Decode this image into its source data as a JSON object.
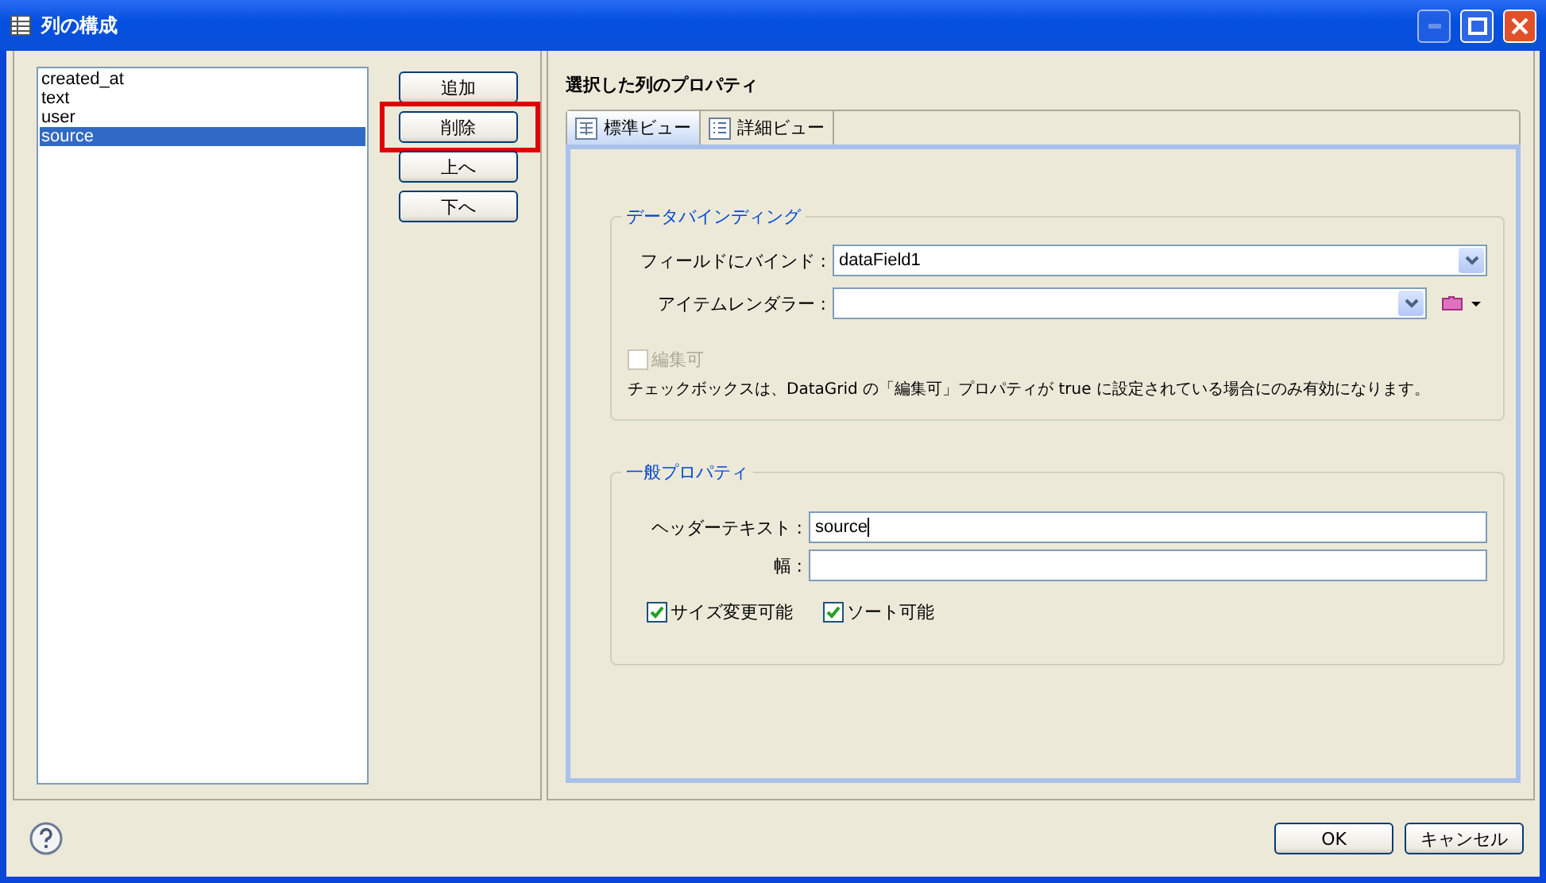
{
  "window": {
    "title": "列の構成"
  },
  "columns_list": {
    "items": [
      {
        "label": "created_at",
        "selected": false
      },
      {
        "label": "text",
        "selected": false
      },
      {
        "label": "user",
        "selected": false
      },
      {
        "label": "source",
        "selected": true
      }
    ]
  },
  "list_buttons": [
    {
      "label": "追加",
      "highlighted": false
    },
    {
      "label": "削除",
      "highlighted": true
    },
    {
      "label": "上へ",
      "highlighted": false
    },
    {
      "label": "下へ",
      "highlighted": false
    }
  ],
  "properties": {
    "title": "選択した列のプロパティ",
    "tabs": [
      {
        "label": "標準ビュー",
        "selected": true,
        "kind": "grid"
      },
      {
        "label": "詳細ビュー",
        "selected": false,
        "kind": "list"
      }
    ],
    "data_binding": {
      "title": "データバインディング",
      "field_label": "フィールドにバインド :",
      "field_value": "dataField1",
      "renderer_label": "アイテムレンダラー :",
      "editable": {
        "label": "編集可",
        "checked": false,
        "disabled": true
      },
      "note": "チェックボックスは、DataGrid の「編集可」プロパティが true に設定されている場合にのみ有効になります。"
    },
    "general": {
      "title": "一般プロパティ",
      "header_label": "ヘッダーテキスト :",
      "header_value": "source",
      "width_label": "幅 :",
      "checkboxes": [
        {
          "label": "サイズ変更可能",
          "checked": true,
          "disabled": false
        },
        {
          "label": "ソート可能",
          "checked": true,
          "disabled": false
        }
      ]
    }
  },
  "footer": {
    "buttons": [
      "OK",
      "キャンセル"
    ]
  }
}
